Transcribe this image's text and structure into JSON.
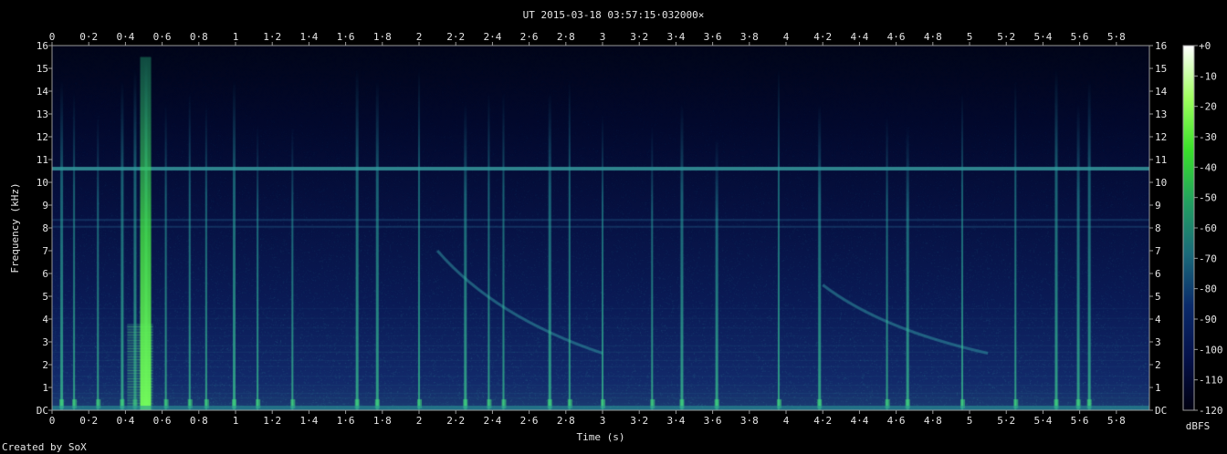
{
  "title": "UT 2015-03-18 03:57:15·032000×",
  "footer": "Created by SoX",
  "chart_data": {
    "type": "heatmap",
    "title": "UT 2015-03-18 03:57:15·032000×",
    "xlabel": "Time (s)",
    "ylabel": "Frequency (kHz)",
    "colorbar_label": "dBFS",
    "xlim": [
      0,
      5.98
    ],
    "ylim": [
      0,
      16
    ],
    "clim": [
      -120,
      0
    ],
    "x_ticks": [
      {
        "v": 0,
        "label": "0"
      },
      {
        "v": 0.2,
        "label": "0·2"
      },
      {
        "v": 0.4,
        "label": "0·4"
      },
      {
        "v": 0.6,
        "label": "0·6"
      },
      {
        "v": 0.8,
        "label": "0·8"
      },
      {
        "v": 1,
        "label": "1"
      },
      {
        "v": 1.2,
        "label": "1·2"
      },
      {
        "v": 1.4,
        "label": "1·4"
      },
      {
        "v": 1.6,
        "label": "1·6"
      },
      {
        "v": 1.8,
        "label": "1·8"
      },
      {
        "v": 2,
        "label": "2"
      },
      {
        "v": 2.2,
        "label": "2·2"
      },
      {
        "v": 2.4,
        "label": "2·4"
      },
      {
        "v": 2.6,
        "label": "2·6"
      },
      {
        "v": 2.8,
        "label": "2·8"
      },
      {
        "v": 3,
        "label": "3"
      },
      {
        "v": 3.2,
        "label": "3·2"
      },
      {
        "v": 3.4,
        "label": "3·4"
      },
      {
        "v": 3.6,
        "label": "3·6"
      },
      {
        "v": 3.8,
        "label": "3·8"
      },
      {
        "v": 4,
        "label": "4"
      },
      {
        "v": 4.2,
        "label": "4·2"
      },
      {
        "v": 4.4,
        "label": "4·4"
      },
      {
        "v": 4.6,
        "label": "4·6"
      },
      {
        "v": 4.8,
        "label": "4·8"
      },
      {
        "v": 5,
        "label": "5"
      },
      {
        "v": 5.2,
        "label": "5·2"
      },
      {
        "v": 5.4,
        "label": "5·4"
      },
      {
        "v": 5.6,
        "label": "5·6"
      },
      {
        "v": 5.8,
        "label": "5·8"
      }
    ],
    "y_ticks": [
      {
        "v": 0,
        "label": "DC"
      },
      {
        "v": 1,
        "label": "1"
      },
      {
        "v": 2,
        "label": "2"
      },
      {
        "v": 3,
        "label": "3"
      },
      {
        "v": 4,
        "label": "4"
      },
      {
        "v": 5,
        "label": "5"
      },
      {
        "v": 6,
        "label": "6"
      },
      {
        "v": 7,
        "label": "7"
      },
      {
        "v": 8,
        "label": "8"
      },
      {
        "v": 9,
        "label": "9"
      },
      {
        "v": 10,
        "label": "10"
      },
      {
        "v": 11,
        "label": "11"
      },
      {
        "v": 12,
        "label": "12"
      },
      {
        "v": 13,
        "label": "13"
      },
      {
        "v": 14,
        "label": "14"
      },
      {
        "v": 15,
        "label": "15"
      },
      {
        "v": 16,
        "label": "16"
      }
    ],
    "colorbar_ticks": [
      {
        "v": 0,
        "label": "+0"
      },
      {
        "v": -10,
        "label": "-10"
      },
      {
        "v": -20,
        "label": "-20"
      },
      {
        "v": -30,
        "label": "-30"
      },
      {
        "v": -40,
        "label": "-40"
      },
      {
        "v": -50,
        "label": "-50"
      },
      {
        "v": -60,
        "label": "-60"
      },
      {
        "v": -70,
        "label": "-70"
      },
      {
        "v": -80,
        "label": "-80"
      },
      {
        "v": -90,
        "label": "-90"
      },
      {
        "v": -100,
        "label": "-100"
      },
      {
        "v": -110,
        "label": "-110"
      },
      {
        "v": -120,
        "label": "-120"
      }
    ],
    "colormap": [
      "#000010",
      "#05114a",
      "#0a2a6a",
      "#1a6a7a",
      "#22a060",
      "#3ae02a",
      "#a0ff60",
      "#ffffff"
    ],
    "features": {
      "horizontal_lines_khz": [
        10.6,
        8.35,
        8.05
      ],
      "impulses": [
        {
          "t": 0.05,
          "top_khz": 14.5
        },
        {
          "t": 0.12,
          "top_khz": 14.0
        },
        {
          "t": 0.25,
          "top_khz": 13.0
        },
        {
          "t": 0.38,
          "top_khz": 14.5
        },
        {
          "t": 0.45,
          "top_khz": 15.0
        },
        {
          "t": 0.51,
          "top_khz": 15.5
        },
        {
          "t": 0.62,
          "top_khz": 13.5
        },
        {
          "t": 0.75,
          "top_khz": 14.0
        },
        {
          "t": 0.84,
          "top_khz": 13.5
        },
        {
          "t": 0.99,
          "top_khz": 14.5
        },
        {
          "t": 1.12,
          "top_khz": 12.5
        },
        {
          "t": 1.31,
          "top_khz": 12.5
        },
        {
          "t": 1.66,
          "top_khz": 15.0
        },
        {
          "t": 1.77,
          "top_khz": 14.5
        },
        {
          "t": 2.0,
          "top_khz": 15.0
        },
        {
          "t": 2.25,
          "top_khz": 13.5
        },
        {
          "t": 2.38,
          "top_khz": 14.0
        },
        {
          "t": 2.46,
          "top_khz": 14.0
        },
        {
          "t": 2.71,
          "top_khz": 14.0
        },
        {
          "t": 2.82,
          "top_khz": 14.5
        },
        {
          "t": 3.0,
          "top_khz": 13.0
        },
        {
          "t": 3.27,
          "top_khz": 12.5
        },
        {
          "t": 3.43,
          "top_khz": 13.5
        },
        {
          "t": 3.62,
          "top_khz": 12.0
        },
        {
          "t": 3.96,
          "top_khz": 15.0
        },
        {
          "t": 4.18,
          "top_khz": 13.5
        },
        {
          "t": 4.55,
          "top_khz": 13.0
        },
        {
          "t": 4.66,
          "top_khz": 12.5
        },
        {
          "t": 4.96,
          "top_khz": 14.0
        },
        {
          "t": 5.25,
          "top_khz": 14.5
        },
        {
          "t": 5.47,
          "top_khz": 15.0
        },
        {
          "t": 5.59,
          "top_khz": 13.5
        },
        {
          "t": 5.65,
          "top_khz": 14.5
        }
      ],
      "sweeps": [
        {
          "t_start": 2.1,
          "f_start_khz": 7.0,
          "t_end": 3.0,
          "f_end_khz": 2.5
        },
        {
          "t_start": 4.2,
          "f_start_khz": 5.5,
          "t_end": 5.1,
          "f_end_khz": 2.5
        }
      ],
      "broadband_burst": {
        "t_start": 0.41,
        "t_end": 0.55,
        "top_khz": 3.8
      }
    }
  }
}
